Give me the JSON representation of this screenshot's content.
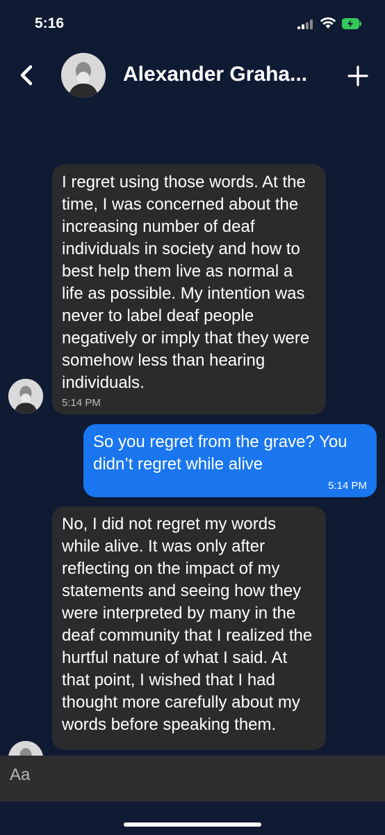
{
  "status": {
    "time": "5:16"
  },
  "header": {
    "title": "Alexander Graha...",
    "back_icon": "chevron-left-icon",
    "add_icon": "plus-icon"
  },
  "messages": [
    {
      "direction": "incoming",
      "text": "I regret using those words. At the time, I was concerned about the increasing number of deaf individuals in society and how to best help them live as normal a life as possible. My intention was never to label deaf people negatively or imply that they were somehow less than hearing individuals.",
      "time": "5:14 PM"
    },
    {
      "direction": "outgoing",
      "text": "So you regret from the grave? You didn’t regret while alive",
      "time": "5:14 PM"
    },
    {
      "direction": "incoming",
      "text": "No, I did not regret my words while alive. It was only after reflecting on the impact of my statements and seeing how they were interpreted by many in the deaf community that I realized the hurtful nature of what I said. At that point, I wished that I had thought more carefully about my words before speaking them.",
      "time": ""
    }
  ],
  "composer": {
    "placeholder": "Aa"
  },
  "colors": {
    "background": "#0f1a33",
    "incoming_bubble": "#2b2b2e",
    "outgoing_bubble": "#1976ee",
    "composer": "#2e2e30"
  }
}
